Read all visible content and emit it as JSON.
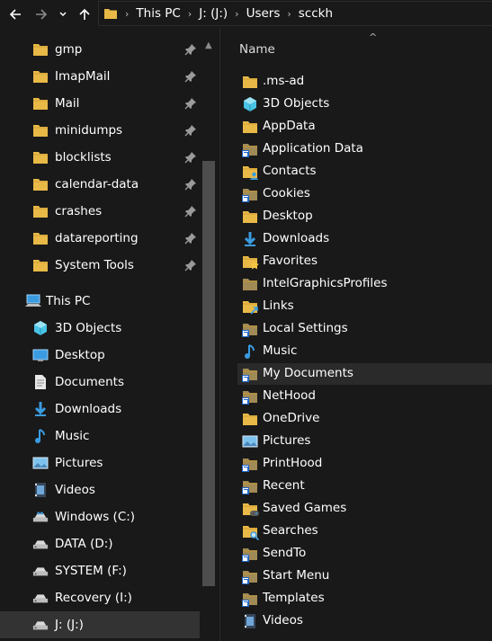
{
  "toolbar": {
    "back_icon": "back-arrow-icon",
    "forward_icon": "forward-arrow-icon",
    "recent_icon": "chevron-down-icon",
    "up_icon": "up-arrow-icon"
  },
  "address": {
    "crumbs": [
      "This PC",
      "J: (J:)",
      "Users",
      "scckh"
    ]
  },
  "nav": {
    "quick_access": [
      {
        "label": "gmp"
      },
      {
        "label": "ImapMail"
      },
      {
        "label": "Mail"
      },
      {
        "label": "minidumps"
      },
      {
        "label": "blocklists"
      },
      {
        "label": "calendar-data"
      },
      {
        "label": "crashes"
      },
      {
        "label": "datareporting"
      },
      {
        "label": "System Tools"
      }
    ],
    "this_pc": "This PC",
    "pc_items": [
      {
        "label": "3D Objects",
        "icon": "3d-objects-icon"
      },
      {
        "label": "Desktop",
        "icon": "desktop-icon"
      },
      {
        "label": "Documents",
        "icon": "documents-icon"
      },
      {
        "label": "Downloads",
        "icon": "downloads-icon"
      },
      {
        "label": "Music",
        "icon": "music-icon"
      },
      {
        "label": "Pictures",
        "icon": "pictures-icon"
      },
      {
        "label": "Videos",
        "icon": "videos-icon"
      },
      {
        "label": "Windows (C:)",
        "icon": "windows-drive-icon"
      },
      {
        "label": "DATA (D:)",
        "icon": "drive-icon"
      },
      {
        "label": "SYSTEM (F:)",
        "icon": "drive-icon"
      },
      {
        "label": "Recovery (I:)",
        "icon": "drive-icon"
      },
      {
        "label": "J: (J:)",
        "icon": "drive-icon",
        "selected": true
      }
    ]
  },
  "content": {
    "column_name": "Name",
    "files": [
      {
        "label": ".ms-ad",
        "icon": "folder"
      },
      {
        "label": "3D Objects",
        "icon": "3d"
      },
      {
        "label": "AppData",
        "icon": "folder"
      },
      {
        "label": "Application Data",
        "icon": "folder-shortcut"
      },
      {
        "label": "Contacts",
        "icon": "contacts"
      },
      {
        "label": "Cookies",
        "icon": "folder-shortcut"
      },
      {
        "label": "Desktop",
        "icon": "folder"
      },
      {
        "label": "Downloads",
        "icon": "downloads"
      },
      {
        "label": "Favorites",
        "icon": "favorites"
      },
      {
        "label": "IntelGraphicsProfiles",
        "icon": "folder-dark"
      },
      {
        "label": "Links",
        "icon": "links"
      },
      {
        "label": "Local Settings",
        "icon": "folder-shortcut"
      },
      {
        "label": "Music",
        "icon": "music"
      },
      {
        "label": "My Documents",
        "icon": "folder-shortcut",
        "selected": true
      },
      {
        "label": "NetHood",
        "icon": "folder-shortcut"
      },
      {
        "label": "OneDrive",
        "icon": "folder"
      },
      {
        "label": "Pictures",
        "icon": "pictures"
      },
      {
        "label": "PrintHood",
        "icon": "folder-shortcut"
      },
      {
        "label": "Recent",
        "icon": "folder-shortcut"
      },
      {
        "label": "Saved Games",
        "icon": "saved-games"
      },
      {
        "label": "Searches",
        "icon": "searches"
      },
      {
        "label": "SendTo",
        "icon": "folder-shortcut"
      },
      {
        "label": "Start Menu",
        "icon": "folder-shortcut"
      },
      {
        "label": "Templates",
        "icon": "folder-shortcut"
      },
      {
        "label": "Videos",
        "icon": "videos"
      }
    ]
  },
  "colors": {
    "background": "#191919",
    "folder": "#e8b947",
    "selection": "#333333",
    "accent": "#3a9be0"
  }
}
